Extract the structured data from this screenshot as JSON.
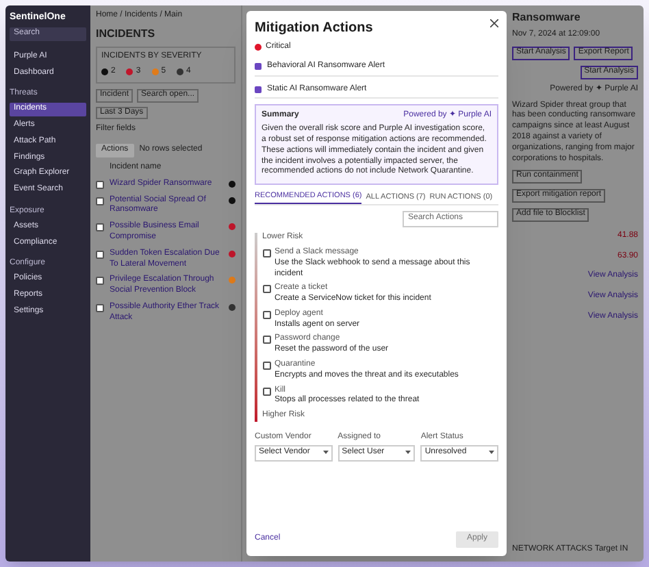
{
  "sidebar": {
    "logo": "SentinelOne",
    "search": {
      "placeholder": "Search"
    },
    "sections": [
      {
        "items": [
          {
            "label": "Purple AI",
            "selected": false
          },
          {
            "label": "Dashboard",
            "selected": false
          }
        ]
      },
      {
        "title": "Threats",
        "items": [
          {
            "label": "Incidents",
            "selected": true
          },
          {
            "label": "Alerts",
            "selected": false
          },
          {
            "label": "Attack Path",
            "selected": false
          },
          {
            "label": "Findings",
            "selected": false
          },
          {
            "label": "Graph Explorer",
            "selected": false
          },
          {
            "label": "Event Search",
            "selected": false
          }
        ]
      },
      {
        "title": "Exposure",
        "items": [
          {
            "label": "Assets",
            "selected": false
          },
          {
            "label": "Compliance",
            "selected": false
          }
        ]
      },
      {
        "title": "Configure",
        "items": [
          {
            "label": "Policies",
            "selected": false
          },
          {
            "label": "Reports",
            "selected": false
          },
          {
            "label": "Settings",
            "selected": false
          }
        ]
      }
    ]
  },
  "incidents": {
    "breadcrumb": "Home / Incidents / Main",
    "title": "INCIDENTS",
    "severity_label": "INCIDENTS BY SEVERITY",
    "severity_counts": [
      {
        "count": "2",
        "color": "#111111"
      },
      {
        "count": "3",
        "color": "#c0162b"
      },
      {
        "count": "5",
        "color": "#e07b1a"
      },
      {
        "count": "4",
        "color": "#333333"
      }
    ],
    "filters": [
      "Incident",
      "Search open...",
      "Last 3 Days"
    ],
    "filter_hint": "Filter fields",
    "action_button": "Actions",
    "action_hint": "No rows selected",
    "column_1": "Incident name",
    "rows": [
      {
        "name": "Wizard Spider Ransomware",
        "checked": false,
        "color": "#111111"
      },
      {
        "name": "Potential Social Spread Of Ransomware",
        "checked": false,
        "color": "#111111"
      },
      {
        "name": "Possible Business Email Compromise",
        "checked": false,
        "color": "#c0162b"
      },
      {
        "name": "Sudden Token Escalation Due To Lateral Movement",
        "checked": false,
        "color": "#c0162b"
      },
      {
        "name": "Privilege Escalation Through Social Prevention Block",
        "checked": false,
        "color": "#e07b1a"
      },
      {
        "name": "Possible Authority Ether Track Attack",
        "checked": false,
        "color": "#333333"
      }
    ]
  },
  "detail": {
    "title": "Ransomware",
    "date": "Nov 7, 2024 at 12:09:00",
    "buttons": [
      "Start Analysis",
      "Export Report"
    ],
    "analysis_button": "Start Analysis",
    "powered": "Powered by ✦ Purple AI",
    "text": "Wizard Spider threat group that has been conducting ransomware campaigns since at least August 2018 against a variety of organizations, ranging from major corporations to hospitals.",
    "actions": [
      "Run containment",
      "Export mitigation report",
      "Add file to Blocklist"
    ],
    "scores": [
      "41.88",
      "63.90"
    ],
    "links": [
      "View Analysis",
      "View Analysis",
      "View Analysis"
    ],
    "footer": "NETWORK ATTACKS Target IN"
  },
  "modal": {
    "title": "Mitigation Actions",
    "severity": {
      "label": "Critical",
      "color": "#e0162b"
    },
    "alerts": [
      "Behavioral AI Ransomware Alert",
      "Static AI Ransomware Alert"
    ],
    "summary": {
      "title": "Summary",
      "powered": "Powered by ✦ Purple AI",
      "text": "Given the overall risk score and Purple AI investigation score, a robust set of response mitigation actions are recommended. These actions will immediately contain the incident and given the incident involves a potentially impacted server, the recommended actions do not include Network Quarantine."
    },
    "tabs": [
      {
        "label": "RECOMMENDED ACTIONS (6)",
        "selected": true
      },
      {
        "label": "ALL ACTIONS (7)",
        "selected": false
      },
      {
        "label": "RUN ACTIONS (0)",
        "selected": false
      }
    ],
    "search": {
      "placeholder": "Search Actions"
    },
    "low_label": "Lower Risk",
    "high_label": "Higher Risk",
    "actions": [
      {
        "name": "Send a Slack message",
        "description": "Use the Slack webhook to send a message about this incident",
        "checked": false
      },
      {
        "name": "Create a ticket",
        "description": "Create a ServiceNow ticket for this incident",
        "checked": false
      },
      {
        "name": "Deploy agent",
        "description": "Installs agent on server",
        "checked": false
      },
      {
        "name": "Password change",
        "description": "Reset the password of the user",
        "checked": false
      },
      {
        "name": "Quarantine",
        "description": "Encrypts and moves the threat and its executables",
        "checked": false
      },
      {
        "name": "Kill",
        "description": "Stops all processes related to the threat",
        "checked": false
      }
    ],
    "fields": [
      {
        "label": "Custom Vendor",
        "value": "Select Vendor"
      },
      {
        "label": "Assigned to",
        "value": "Select User"
      },
      {
        "label": "Alert Status",
        "value": "Unresolved"
      }
    ],
    "cancel": "Cancel",
    "apply": {
      "label": "Apply",
      "disabled": true
    }
  }
}
